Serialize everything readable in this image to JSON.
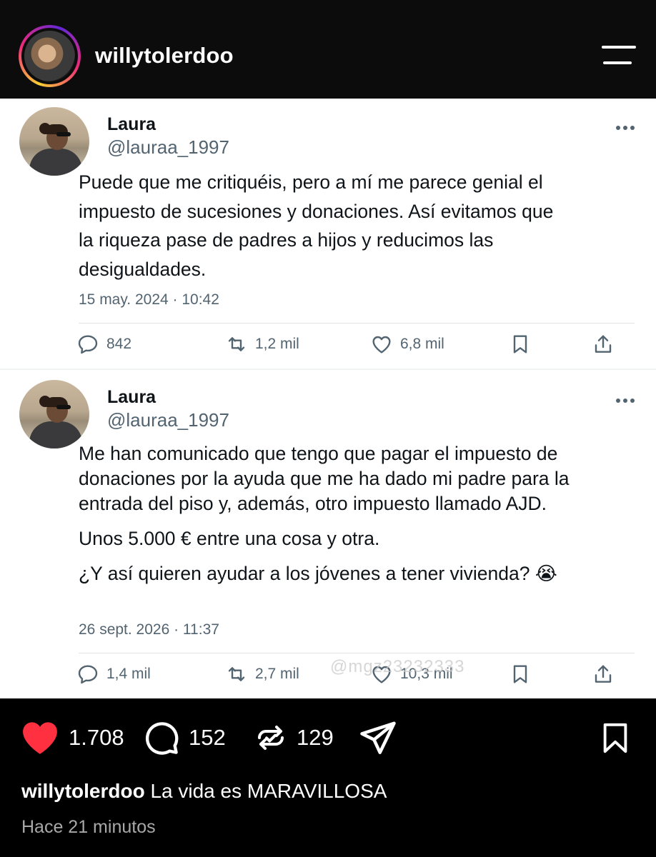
{
  "header": {
    "username": "willytolerdoo"
  },
  "tweets": [
    {
      "name": "Laura",
      "handle": "@lauraa_1997",
      "paragraphs": [
        "Puede que me critiquéis, pero a mí me parece genial el impuesto de sucesiones y donaciones. Así evitamos que la riqueza pase de padres a hijos y reducimos las desigualdades."
      ],
      "date": "15 may. 2024 · 10:42",
      "replies": "842",
      "retweets": "1,2 mil",
      "likes": "6,8 mil"
    },
    {
      "name": "Laura",
      "handle": "@lauraa_1997",
      "paragraphs": [
        "Me han comunicado que tengo que pagar el impuesto de donaciones por la ayuda que me ha dado mi padre para la entrada del piso y, además, otro impuesto llamado AJD.",
        "Unos 5.000 € entre una cosa y otra.",
        "¿Y así quieren ayudar a los jóvenes a tener vivienda? 😭"
      ],
      "date": "26 sept. 2026 · 11:37",
      "replies": "1,4 mil",
      "retweets": "2,7 mil",
      "likes": "10,3 mil",
      "watermark": "@mgz23232333"
    }
  ],
  "post": {
    "likes": "1.708",
    "comments": "152",
    "reposts": "129",
    "caption_user": "willytolerdoo",
    "caption_text": "La vida es MARAVILLOSA",
    "time_ago": "Hace 21 minutos"
  },
  "colors": {
    "like_red": "#ff3040",
    "tweet_gray": "#536471",
    "header_bg": "#0c0c0c"
  }
}
